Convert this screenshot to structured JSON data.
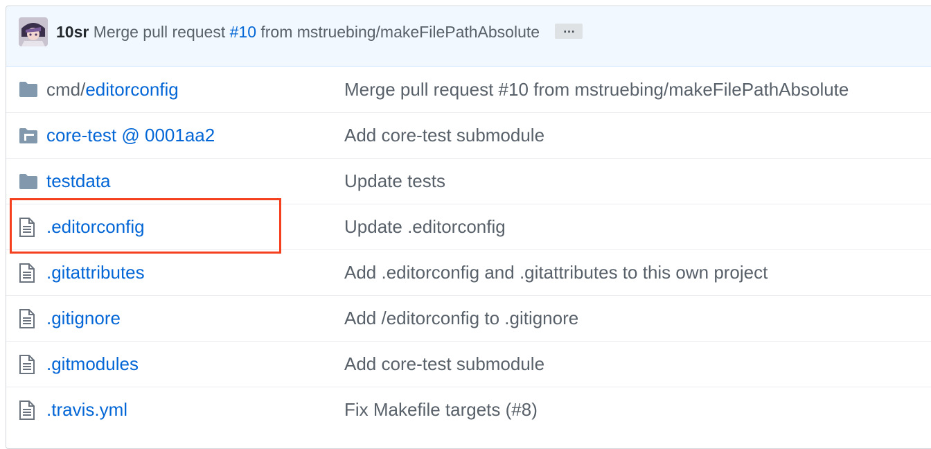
{
  "commit": {
    "author": "10sr",
    "message_prefix": "Merge pull request",
    "pr_link": "#10",
    "message_suffix": "from mstruebing/makeFilePathAbsolute",
    "ellipsis": "…"
  },
  "files": [
    {
      "type": "folder",
      "icon": "folder-icon",
      "name_prefix": "cmd/",
      "name": "editorconfig",
      "message": "Merge pull request #10 from mstruebing/makeFilePathAbsolute"
    },
    {
      "type": "submodule",
      "icon": "submodule-icon",
      "name_prefix": "",
      "name": "core-test @ 0001aa2",
      "message": "Add core-test submodule"
    },
    {
      "type": "folder",
      "icon": "folder-icon",
      "name_prefix": "",
      "name": "testdata",
      "message": "Update tests"
    },
    {
      "type": "file",
      "icon": "file-icon",
      "name_prefix": "",
      "name": ".editorconfig",
      "message": "Update .editorconfig"
    },
    {
      "type": "file",
      "icon": "file-icon",
      "name_prefix": "",
      "name": ".gitattributes",
      "message": "Add .editorconfig and .gitattributes to this own project"
    },
    {
      "type": "file",
      "icon": "file-icon",
      "name_prefix": "",
      "name": ".gitignore",
      "message": "Add /editorconfig to .gitignore"
    },
    {
      "type": "file",
      "icon": "file-icon",
      "name_prefix": "",
      "name": ".gitmodules",
      "message": "Add core-test submodule"
    },
    {
      "type": "file",
      "icon": "file-icon",
      "name_prefix": "",
      "name": ".travis.yml",
      "message": "Fix Makefile targets (#8)"
    }
  ],
  "colors": {
    "link": "#0366d6",
    "muted": "#586069",
    "icon": "#8198ad",
    "highlight": "#f5401f",
    "commit_bg": "#f1f8ff"
  }
}
